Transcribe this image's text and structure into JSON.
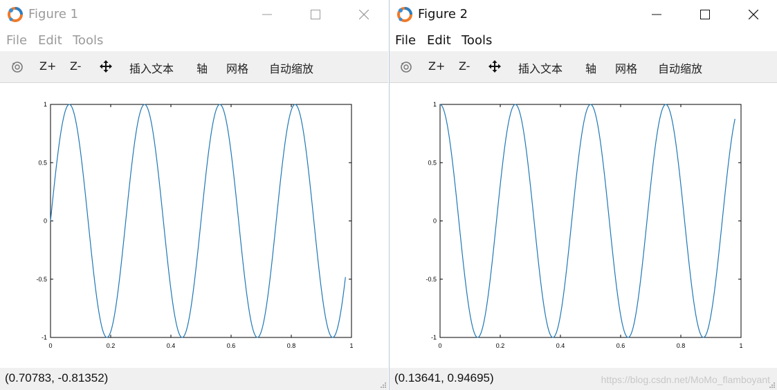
{
  "windows": [
    {
      "title": "Figure 1",
      "active": false,
      "menu": [
        "File",
        "Edit",
        "Tools"
      ],
      "toolbar": {
        "zoom_in": "Z+",
        "zoom_out": "Z-",
        "insert_text": "插入文本",
        "axes": "轴",
        "grid": "网格",
        "autoscale": "自动缩放"
      },
      "status": "(0.70783, -0.81352)",
      "chart_data": {
        "type": "line",
        "function": "sin(2*pi*4*x)",
        "x_range": [
          0,
          0.98
        ],
        "series": [
          {
            "color": "#1f77b4"
          }
        ],
        "xlim": [
          0,
          1
        ],
        "ylim": [
          -1,
          1
        ],
        "xticks": [
          "0",
          "0.2",
          "0.4",
          "0.6",
          "0.8",
          "1"
        ],
        "yticks": [
          "1",
          "0.5",
          "0",
          "-0.5",
          "-1"
        ],
        "grid": false
      }
    },
    {
      "title": "Figure 2",
      "active": true,
      "menu": [
        "File",
        "Edit",
        "Tools"
      ],
      "toolbar": {
        "zoom_in": "Z+",
        "zoom_out": "Z-",
        "insert_text": "插入文本",
        "axes": "轴",
        "grid": "网格",
        "autoscale": "自动缩放"
      },
      "status": "(0.13641, 0.94695)",
      "watermark": "https://blog.csdn.net/MoMo_flamboyant",
      "chart_data": {
        "type": "line",
        "function": "cos(2*pi*4*x)",
        "x_range": [
          0,
          0.98
        ],
        "series": [
          {
            "color": "#1f77b4"
          }
        ],
        "xlim": [
          0,
          1
        ],
        "ylim": [
          -1,
          1
        ],
        "xticks": [
          "0",
          "0.2",
          "0.4",
          "0.6",
          "0.8",
          "1"
        ],
        "yticks": [
          "1",
          "0.5",
          "0",
          "-0.5",
          "-1"
        ],
        "grid": false
      }
    }
  ]
}
